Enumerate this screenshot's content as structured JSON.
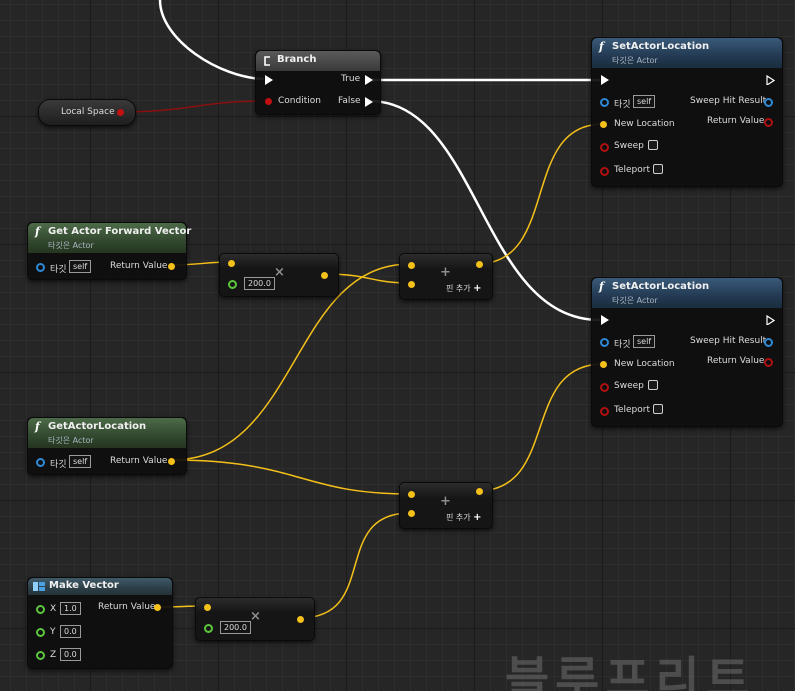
{
  "colors": {
    "exec_wire": "#ffffff",
    "vector_wire": "#f4c019",
    "bool_wire": "#8a1010",
    "object_pin": "#2e8ad6",
    "float_pin": "#5cc73c"
  },
  "local_space": {
    "label": "Local Space"
  },
  "branch": {
    "title": "Branch",
    "icon": "branch-icon",
    "true_label": "True",
    "condition_label": "Condition",
    "false_label": "False"
  },
  "set_actor_location": [
    {
      "title": "SetActorLocation",
      "subtitle": "타깃은 Actor",
      "target_label": "타깃",
      "target_value": "self",
      "new_location_label": "New Location",
      "sweep_label": "Sweep",
      "teleport_label": "Teleport",
      "sweep_hit_result_label": "Sweep Hit Result",
      "return_value_label": "Return Value"
    },
    {
      "title": "SetActorLocation",
      "subtitle": "타깃은 Actor",
      "target_label": "타깃",
      "target_value": "self",
      "new_location_label": "New Location",
      "sweep_label": "Sweep",
      "teleport_label": "Teleport",
      "sweep_hit_result_label": "Sweep Hit Result",
      "return_value_label": "Return Value"
    }
  ],
  "get_actor_forward_vector": {
    "title": "Get Actor Forward Vector",
    "subtitle": "타깃은 Actor",
    "target_label": "타깃",
    "target_value": "self",
    "return_value_label": "Return Value"
  },
  "get_actor_location": {
    "title": "GetActorLocation",
    "subtitle": "타깃은 Actor",
    "target_label": "타깃",
    "target_value": "self",
    "return_value_label": "Return Value"
  },
  "multiply_nodes": [
    {
      "operator": "×",
      "value": "200.0"
    },
    {
      "operator": "×",
      "value": "200.0"
    }
  ],
  "add_nodes": [
    {
      "operator": "+",
      "add_pin_label": "핀 추가"
    },
    {
      "operator": "+",
      "add_pin_label": "핀 추가"
    }
  ],
  "make_vector": {
    "title": "Make Vector",
    "x_label": "X",
    "x_value": "1.0",
    "y_label": "Y",
    "y_value": "0.0",
    "z_label": "Z",
    "z_value": "0.0",
    "return_value_label": "Return Value"
  },
  "watermark": "블루프리트"
}
